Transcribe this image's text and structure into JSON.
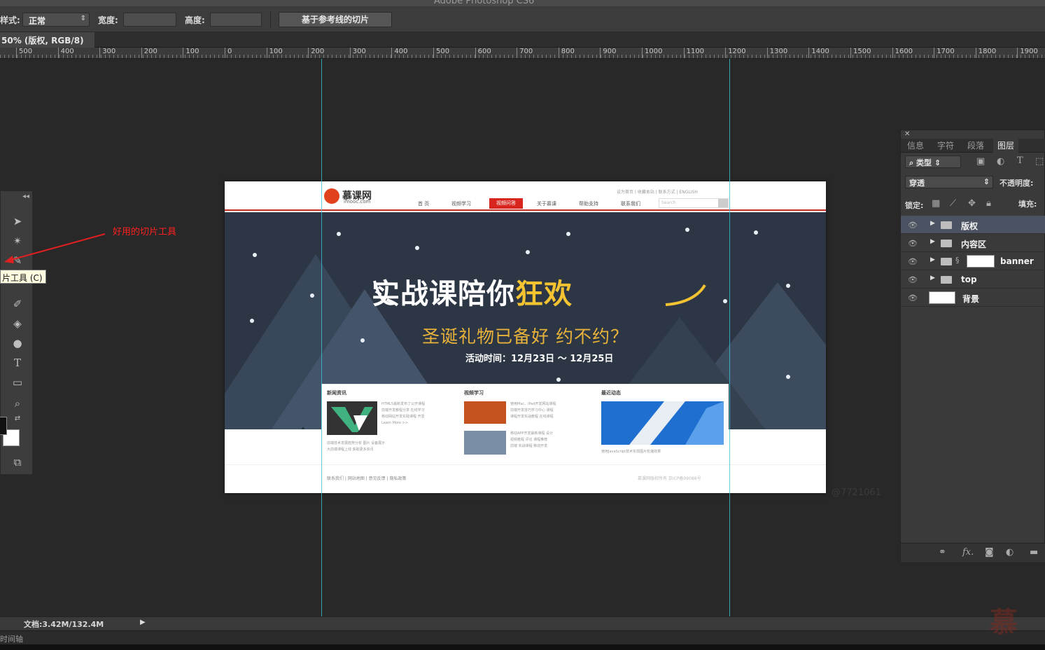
{
  "app": {
    "title": "Adobe Photoshop CS6"
  },
  "options_bar": {
    "style_label": "样式:",
    "style_value": "正常",
    "width_label": "宽度:",
    "height_label": "高度:",
    "slice_from_guides_label": "基于参考线的切片"
  },
  "document": {
    "tab_label": "50% (版权, RGB/8)"
  },
  "ruler": {
    "ticks": [
      "500",
      "400",
      "300",
      "200",
      "100",
      "0",
      "100",
      "200",
      "300",
      "400",
      "500",
      "600",
      "700",
      "800",
      "900",
      "1000",
      "1100",
      "1200",
      "1300",
      "1400",
      "1500",
      "1600",
      "1700",
      "1800",
      "1900"
    ]
  },
  "toolbar": {
    "tooltip": "片工具 (C)",
    "annotation": "好用的切片工具"
  },
  "site": {
    "logo_text": "慕课网",
    "logo_sub": "imooc.com",
    "top_links": "设为首页 | 收藏本站 | 联系方式 | ENGLISH",
    "nav": [
      "首 页",
      "视频学习",
      "视频问答",
      "关于慕课",
      "帮助支持",
      "联系我们"
    ],
    "search_placeholder": "Search",
    "banner_title_main": "实战课陪你",
    "banner_title_highlight": "狂欢",
    "banner_subtitle": "圣诞礼物已备好 约不约？",
    "banner_date": "活动时间：12月23日 ～ 12月25日",
    "col_titles": [
      "新闻资讯",
      "视频学习",
      "最近动态"
    ],
    "col1_lines": "HTML5最新发布了公开课程\n前端开发教程分享 在线学习\n移动网站开发实践课程 开发\nLearn More >>",
    "col1_more": "前端技术发展趋势分析 图片 设备展示\n大前端课程上线 获取更多资讯",
    "col2_lines": "使用Mac、iPad开发网站课程\n前端开发技巧学习中心 课程\n课程开发实战教程 在线课程",
    "col2_more": "移动APP开发最新课程 设计\n视频教程 评论 课程推荐\n前端 实战课程 移动开发",
    "col3_line": "使用JavaScript技术实现图片轮播效果",
    "footer_links": "联系我们 | 网站地图 | 意见反馈 | 隐私政策",
    "footer_copy": "慕课网版权所有 京ICP备09088号"
  },
  "canvas_watermark": "@7721061",
  "layers_panel": {
    "tabs": [
      "信息",
      "字符",
      "段落",
      "图层"
    ],
    "active_tab": "图层",
    "filter_label": "类型",
    "blend_mode": "穿透",
    "opacity_label": "不透明度:",
    "lock_label": "锁定:",
    "fill_label": "填充:",
    "layers": [
      {
        "name": "版权",
        "type": "group",
        "selected": true
      },
      {
        "name": "内容区",
        "type": "group",
        "selected": false
      },
      {
        "name": "banner",
        "type": "group-mask",
        "selected": false
      },
      {
        "name": "top",
        "type": "group",
        "selected": false
      },
      {
        "name": "背景",
        "type": "background",
        "selected": false
      }
    ],
    "footer_fx": "fx."
  },
  "status": {
    "doc_size": "文档:3.42M/132.4M",
    "timeline_label": "时间轴"
  },
  "brand_watermark": "慕",
  "colors": {
    "guide": "#37c6d8",
    "accent_red": "#d8261e",
    "banner_bg": "#2c3644",
    "highlight_yellow": "#f3c332"
  }
}
